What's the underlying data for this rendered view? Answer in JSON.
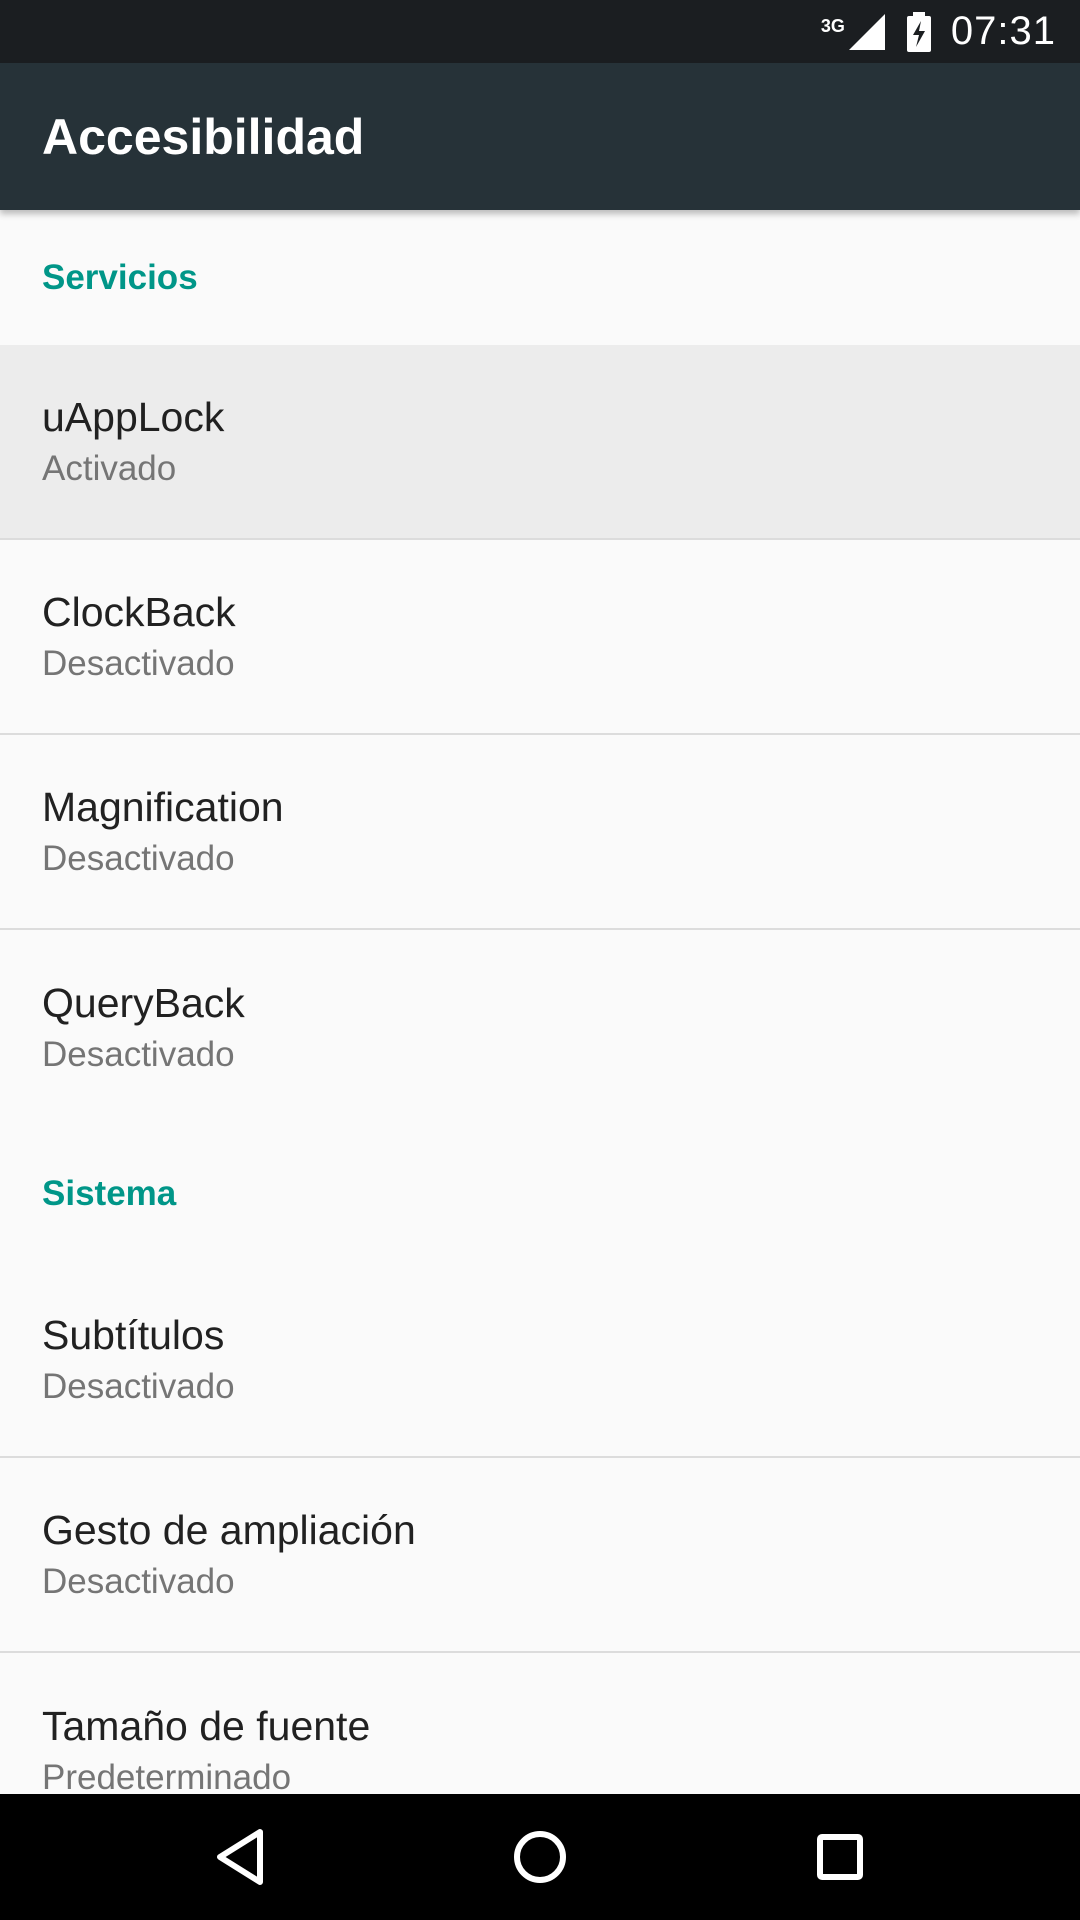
{
  "status_bar": {
    "network_label": "3G",
    "time": "07:31",
    "icons": [
      "signal-icon",
      "battery-charging-icon"
    ]
  },
  "app_bar": {
    "title": "Accesibilidad"
  },
  "sections": [
    {
      "header": "Servicios",
      "items": [
        {
          "title": "uAppLock",
          "summary": "Activado"
        },
        {
          "title": "ClockBack",
          "summary": "Desactivado"
        },
        {
          "title": "Magnification",
          "summary": "Desactivado"
        },
        {
          "title": "QueryBack",
          "summary": "Desactivado"
        }
      ]
    },
    {
      "header": "Sistema",
      "items": [
        {
          "title": "Subtítulos",
          "summary": "Desactivado"
        },
        {
          "title": "Gesto de ampliación",
          "summary": "Desactivado"
        },
        {
          "title": "Tamaño de fuente",
          "summary": "Predeterminado"
        }
      ]
    }
  ],
  "nav_bar": {
    "icons": [
      "back-icon",
      "home-icon",
      "recents-icon"
    ]
  },
  "colors": {
    "accent": "#009688",
    "app_bar": "#263238",
    "status_bar": "#1b1e21"
  }
}
